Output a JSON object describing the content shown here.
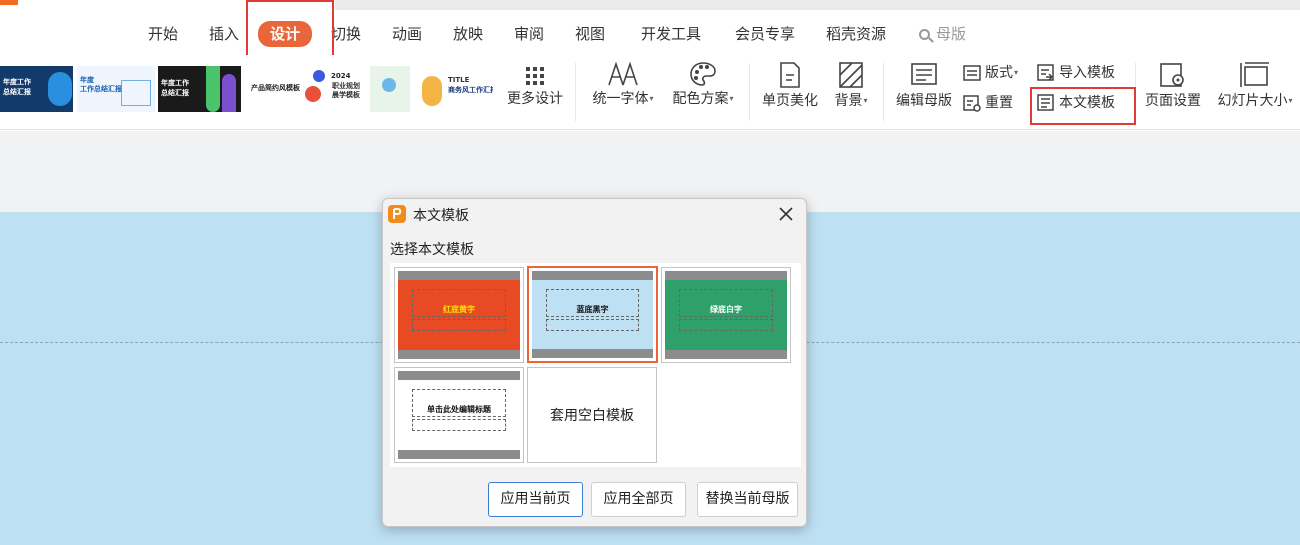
{
  "tabs": [
    {
      "label": "开始"
    },
    {
      "label": "插入"
    },
    {
      "label": "设计"
    },
    {
      "label": "切换"
    },
    {
      "label": "动画"
    },
    {
      "label": "放映"
    },
    {
      "label": "审阅"
    },
    {
      "label": "视图"
    },
    {
      "label": "开发工具"
    },
    {
      "label": "会员专享"
    },
    {
      "label": "稻壳资源"
    }
  ],
  "search": {
    "label": "母版"
  },
  "thumbnails": [
    {
      "lines": [
        "年度工作",
        "总结汇报"
      ]
    },
    {
      "lines": [
        "年度",
        "工作总结汇报"
      ]
    },
    {
      "lines": [
        "年度工作",
        "总结汇报"
      ]
    },
    {
      "lines": [
        "产品简约风模板"
      ]
    },
    {
      "lines": [
        "职业规划",
        "晨学模板"
      ]
    },
    {
      "lines": [
        "TITLE",
        "商务风工作汇报"
      ]
    }
  ],
  "ribbon": {
    "more_design": "更多设计",
    "unify_font": "统一字体",
    "color_scheme": "配色方案",
    "single_page": "单页美化",
    "background": "背景",
    "edit_master": "编辑母版",
    "layout": "版式",
    "reset": "重置",
    "import_template": "导入模板",
    "text_template": "本文模板",
    "page_setup": "页面设置",
    "slide_size": "幻灯片大小"
  },
  "dialog": {
    "title": "本文模板",
    "subtitle": "选择本文模板",
    "templates": [
      {
        "name": "红底黄字",
        "bg": "#e84a23",
        "fg": "#f5e200"
      },
      {
        "name": "蓝底黑字",
        "bg": "#bde0f2",
        "fg": "#111111"
      },
      {
        "name": "绿底白字",
        "bg": "#2fa06a",
        "fg": "#ffffff"
      },
      {
        "name": "单击此处编辑标题",
        "bg": "#ffffff",
        "fg": "#111111"
      }
    ],
    "blank_template": "套用空白模板",
    "btn_apply_current": "应用当前页",
    "btn_apply_all": "应用全部页",
    "btn_replace_master": "替换当前母版"
  },
  "colors": {
    "accent": "#e8663a",
    "highlight_red": "#e23b36",
    "slide_bg": "#bde0f2"
  }
}
